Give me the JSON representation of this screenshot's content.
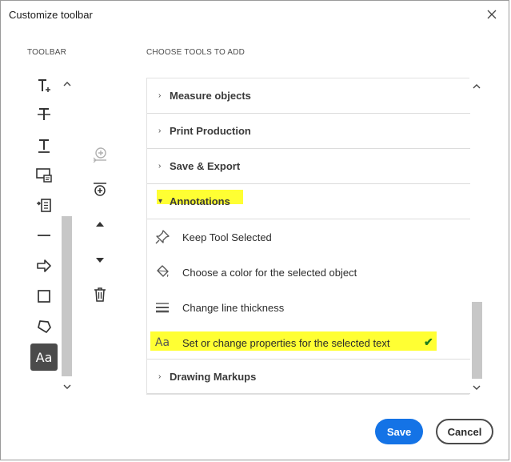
{
  "window": {
    "title": "Customize toolbar"
  },
  "labels": {
    "toolbar": "TOOLBAR",
    "choose_tools": "CHOOSE TOOLS TO ADD"
  },
  "toolbar_items": [
    {
      "icon": "add-text-icon"
    },
    {
      "icon": "strikethrough-icon"
    },
    {
      "icon": "underline-icon"
    },
    {
      "icon": "text-callout-icon"
    },
    {
      "icon": "insert-text-icon"
    },
    {
      "icon": "line-icon"
    },
    {
      "icon": "arrow-icon"
    },
    {
      "icon": "rectangle-icon"
    },
    {
      "icon": "polygon-icon"
    },
    {
      "icon": "text-properties-icon",
      "text": "Aa",
      "selected": true
    }
  ],
  "middle_actions": [
    {
      "icon": "add-tool-icon",
      "enabled": false
    },
    {
      "icon": "add-separator-icon",
      "enabled": true
    },
    {
      "icon": "move-up-icon",
      "enabled": true
    },
    {
      "icon": "move-down-icon",
      "enabled": true
    },
    {
      "icon": "delete-icon",
      "enabled": true
    }
  ],
  "categories": [
    {
      "label": "Measure objects"
    },
    {
      "label": "Print Production"
    },
    {
      "label": "Save & Export"
    },
    {
      "label": "Annotations",
      "expanded": true
    },
    {
      "label": "Drawing Markups"
    }
  ],
  "annotation_tools": [
    {
      "icon": "pin-icon",
      "label": "Keep Tool Selected"
    },
    {
      "icon": "paint-bucket-icon",
      "label": "Choose a color for the selected object"
    },
    {
      "icon": "line-thickness-icon",
      "label": "Change line thickness"
    },
    {
      "icon": "text-properties-icon",
      "icon_text": "Aa",
      "label": "Set or change properties for the selected text",
      "checked": true
    }
  ],
  "buttons": {
    "save": "Save",
    "cancel": "Cancel"
  },
  "colors": {
    "primary": "#1473e6",
    "highlight": "#ffff33",
    "check": "#1e7d1e"
  }
}
